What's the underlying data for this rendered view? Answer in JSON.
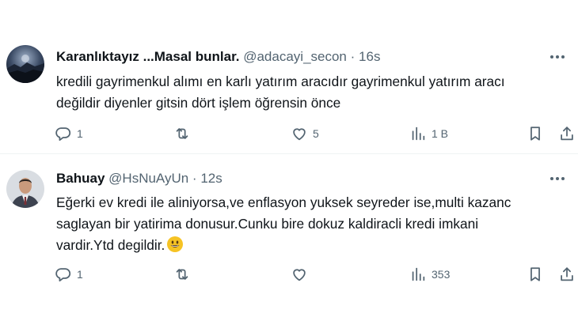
{
  "tweets": [
    {
      "author_name": "Karanlıktayız ...Masal bunlar.",
      "handle": "@adacayi_secon",
      "separator": "·",
      "time": "16s",
      "text_lines": [
        "kredili gayrimenkul alımı en karlı yatırım aracıdır gayrimenkul yatırım aracı",
        "değildir diyenler gitsin dört işlem öğrensin önce"
      ],
      "reply_count": "1",
      "retweet_count": "",
      "like_count": "5",
      "view_count": "1 B",
      "avatar": "night-landscape-avatar"
    },
    {
      "author_name": "Bahuay",
      "handle": "@HsNuAyUn",
      "separator": "·",
      "time": "12s",
      "text_lines": [
        "Eğerki ev kredi ile aliniyorsa,ve enflasyon yuksek seyreder ise,multi kazanc",
        "saglayan bir yatirima donusur.Cunku bire dokuz kaldiracli kredi imkani",
        "vardir.Ytd degildir."
      ],
      "emoji": "grinning-face-emoji",
      "reply_count": "1",
      "retweet_count": "",
      "like_count": "",
      "view_count": "353",
      "avatar": "man-in-suit-avatar"
    }
  ],
  "icons": {
    "reply": "reply-icon",
    "retweet": "retweet-icon",
    "like": "heart-icon",
    "views": "views-icon",
    "bookmark": "bookmark-icon",
    "share": "share-icon",
    "more": "more-icon"
  },
  "colors": {
    "text": "#0f1419",
    "secondary": "#536471",
    "divider": "#eff3f4",
    "emoji": "#f6c324"
  }
}
